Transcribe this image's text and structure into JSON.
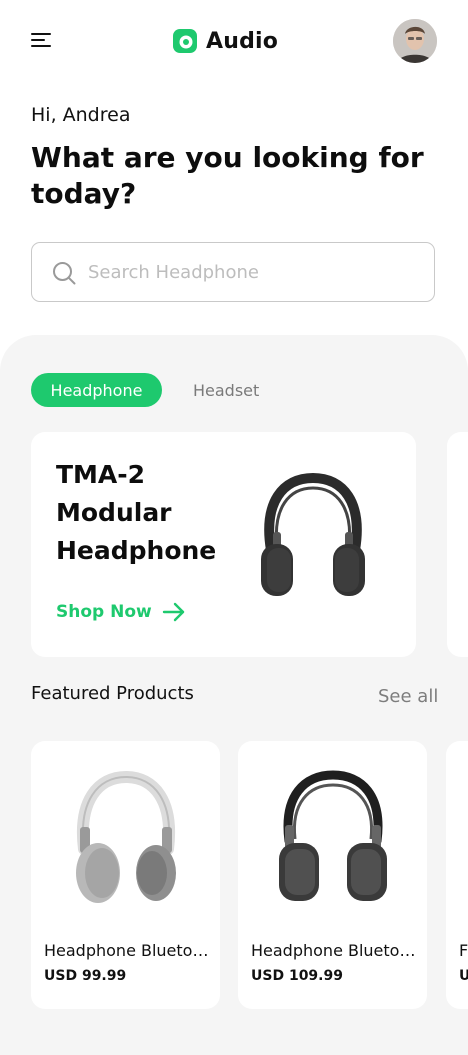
{
  "header": {
    "app_name": "Audio",
    "brand_color": "#1ec96e"
  },
  "greeting": "Hi, Andrea",
  "headline": "What are you looking for today?",
  "search": {
    "placeholder": "Search Headphone",
    "value": ""
  },
  "tabs": [
    {
      "label": "Headphone",
      "active": true
    },
    {
      "label": "Headset",
      "active": false
    }
  ],
  "banner": {
    "title": "TMA-2 Modular Headphone",
    "cta": "Shop Now"
  },
  "featured": {
    "title": "Featured Products",
    "see_all": "See all",
    "products": [
      {
        "name": "Headphone Bluetooth",
        "price": "USD 99.99"
      },
      {
        "name": "Headphone Bluetooth",
        "price": "USD 109.99"
      },
      {
        "name": "F",
        "price": "U"
      }
    ]
  }
}
